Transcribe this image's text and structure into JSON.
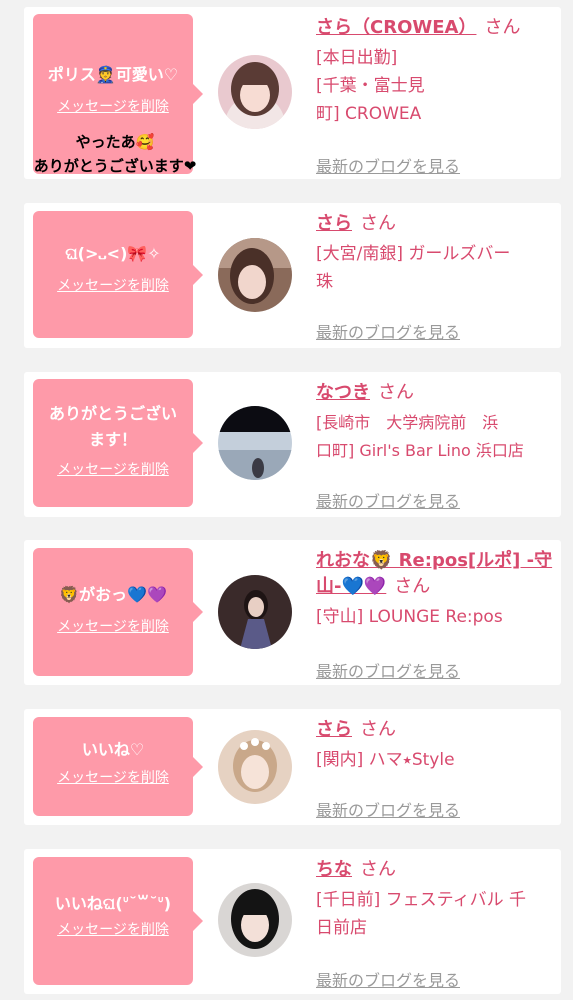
{
  "colors": {
    "page_bg": "#f2f2f2",
    "card_bg": "#ffffff",
    "bubble_bg": "#fe9aa9",
    "accent": "#d84a6e",
    "muted": "#9a9a9a"
  },
  "items": [
    {
      "message": "ポリス👮可愛い♡",
      "delete_label": "メッセージを削除",
      "overlay_text": "やったあ🥰\nありがとうございます❤",
      "name": "さら（CROWEA）",
      "suffix": "さん",
      "shop": "[本日出勤]\n[千葉・富士見\n町] CROWEA",
      "blog_label": "最新のブログを見る"
    },
    {
      "message": "ଘ(>᎑<)🎀✧",
      "delete_label": "メッセージを削除",
      "name": "さら",
      "suffix": "さん",
      "shop": "[大宮/南銀] ガールズバー\n珠",
      "blog_label": "最新のブログを見る"
    },
    {
      "message": "ありがとうござい\nます！",
      "delete_label": "メッセージを削除",
      "name": "なつき",
      "suffix": "さん",
      "shop": "[長崎市　大学病院前　浜\n口町] Girl's Bar Lino 浜口店",
      "blog_label": "最新のブログを見る"
    },
    {
      "message": "🦁がおっ💙💜",
      "delete_label": "メッセージを削除",
      "name": "れおな🦁 Re:pos[ルポ] -守山-💙💜",
      "suffix": "さん",
      "shop": "[守山] LOUNGE Re:pos",
      "blog_label": "最新のブログを見る"
    },
    {
      "message": "いいね♡",
      "delete_label": "メッセージを削除",
      "name": "さら",
      "suffix": "さん",
      "shop": "[関内] ハマ⭑Style",
      "blog_label": "最新のブログを見る"
    },
    {
      "message": "いいねଘ(ᐡ˘꒳˘ᐡ)",
      "delete_label": "メッセージを削除",
      "name": "ちな",
      "suffix": "さん",
      "shop": "[千日前] フェスティバル 千\n日前店",
      "blog_label": "最新のブログを見る"
    }
  ]
}
